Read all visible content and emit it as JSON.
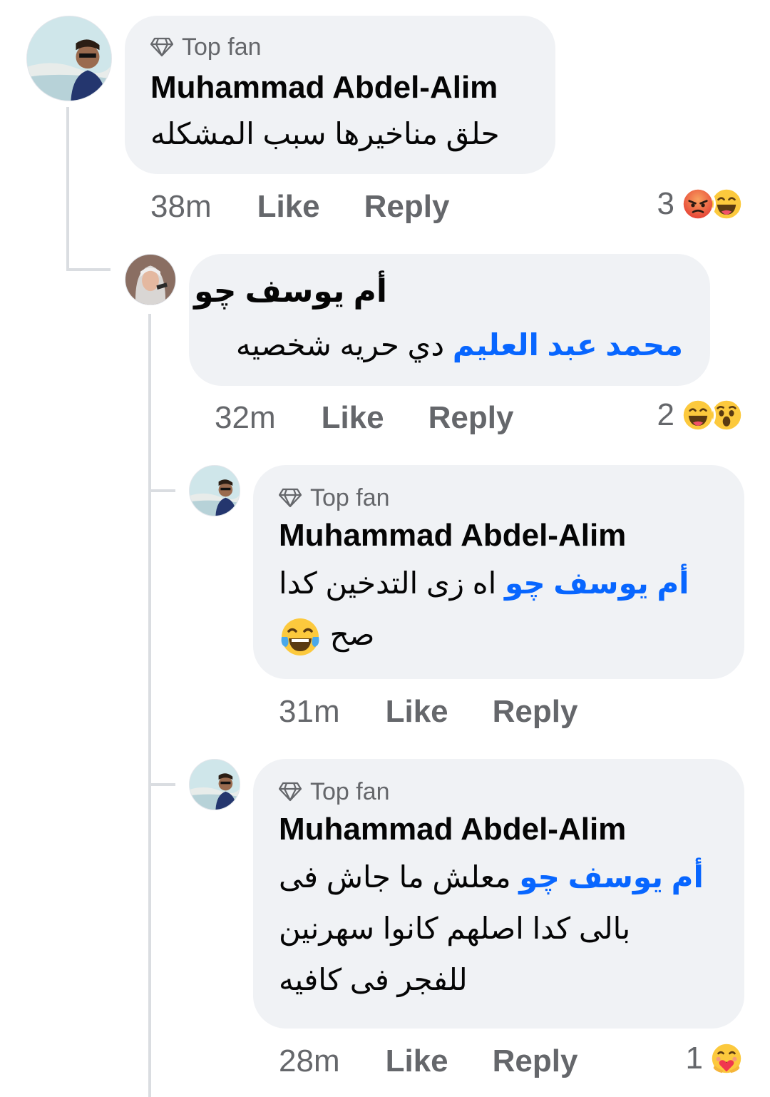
{
  "comments": [
    {
      "badge": "Top fan",
      "author": "Muhammad Abdel-Alim",
      "text": "حلق مناخيرها سبب المشكله",
      "time": "38m",
      "like": "Like",
      "reply": "Reply",
      "reaction_count": "3",
      "reactions": [
        "angry-face",
        "laughing-face"
      ]
    },
    {
      "author": "أم يوسف چو",
      "mention": "محمد عبد العليم",
      "text": "دي حريه شخصيه",
      "time": "32m",
      "like": "Like",
      "reply": "Reply",
      "reaction_count": "2",
      "reactions": [
        "laughing-face",
        "surprised-face"
      ]
    },
    {
      "badge": "Top fan",
      "author": "Muhammad Abdel-Alim",
      "mention": "أم يوسف چو",
      "text": "اه زى التدخين كدا",
      "text_line2": "صح",
      "emoji": "face-with-tears-of-joy",
      "time": "31m",
      "like": "Like",
      "reply": "Reply"
    },
    {
      "badge": "Top fan",
      "author": "Muhammad Abdel-Alim",
      "mention": "أم يوسف چو",
      "text": "معلش ما جاش فى",
      "text_line2": "بالى كدا اصلهم كانوا سهرنين",
      "text_line3": "للفجر فى كافيه",
      "time": "28m",
      "like": "Like",
      "reply": "Reply",
      "reaction_count": "1",
      "reactions": [
        "care-face"
      ]
    }
  ],
  "colors": {
    "bubble": "#f0f2f5",
    "mention": "#0866ff",
    "meta": "#65676b",
    "text": "#050505"
  }
}
